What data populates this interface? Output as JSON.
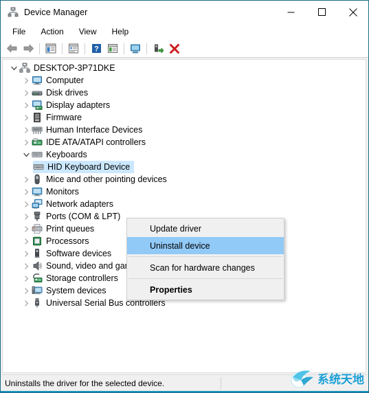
{
  "window": {
    "title": "Device Manager",
    "icon": "device-manager-icon",
    "border_color": "#1b6a8a",
    "controls": [
      {
        "name": "minimize",
        "glyph": "—"
      },
      {
        "name": "maximize",
        "glyph": "□"
      },
      {
        "name": "close",
        "glyph": "✕"
      }
    ]
  },
  "menubar": {
    "items": [
      {
        "label": "File"
      },
      {
        "label": "Action"
      },
      {
        "label": "View"
      },
      {
        "label": "Help"
      }
    ]
  },
  "toolbar": {
    "buttons": [
      {
        "name": "back-icon",
        "tip": "Back"
      },
      {
        "name": "forward-icon",
        "tip": "Forward"
      },
      {
        "name": "show-hide-console-tree-icon",
        "tip": "Show/Hide Console Tree"
      },
      {
        "name": "properties-icon",
        "tip": "Properties"
      },
      {
        "name": "help-icon",
        "tip": "Help"
      },
      {
        "name": "update-driver-icon",
        "tip": "Update Driver Software"
      },
      {
        "name": "scan-hardware-changes-icon",
        "tip": "Scan for hardware changes"
      },
      {
        "name": "enable-device-icon",
        "tip": "Enable device"
      },
      {
        "name": "uninstall-device-icon",
        "tip": "Uninstall device"
      }
    ]
  },
  "tree": {
    "root": {
      "label": "DESKTOP-3P71DKE",
      "icon": "computer-root-icon",
      "expanded": true
    },
    "nodes": [
      {
        "label": "Computer",
        "icon": "computer-icon",
        "expanded": false,
        "selected": false,
        "depth": 1
      },
      {
        "label": "Disk drives",
        "icon": "disk-drive-icon",
        "expanded": false,
        "selected": false,
        "depth": 1
      },
      {
        "label": "Display adapters",
        "icon": "display-adapter-icon",
        "expanded": false,
        "selected": false,
        "depth": 1
      },
      {
        "label": "Firmware",
        "icon": "firmware-icon",
        "expanded": false,
        "selected": false,
        "depth": 1
      },
      {
        "label": "Human Interface Devices",
        "icon": "hid-icon",
        "expanded": false,
        "selected": false,
        "depth": 1
      },
      {
        "label": "IDE ATA/ATAPI controllers",
        "icon": "ide-controller-icon",
        "expanded": false,
        "selected": false,
        "depth": 1
      },
      {
        "label": "Keyboards",
        "icon": "keyboard-icon",
        "expanded": true,
        "selected": false,
        "depth": 1
      },
      {
        "label": "HID Keyboard Device",
        "icon": "keyboard-icon",
        "expanded": null,
        "selected": true,
        "depth": 2
      },
      {
        "label": "Mice and other pointing devices",
        "icon": "mouse-icon",
        "expanded": false,
        "selected": false,
        "depth": 1
      },
      {
        "label": "Monitors",
        "icon": "monitor-icon",
        "expanded": false,
        "selected": false,
        "depth": 1
      },
      {
        "label": "Network adapters",
        "icon": "network-adapter-icon",
        "expanded": false,
        "selected": false,
        "depth": 1
      },
      {
        "label": "Ports (COM & LPT)",
        "icon": "port-icon",
        "expanded": false,
        "selected": false,
        "depth": 1
      },
      {
        "label": "Print queues",
        "icon": "printer-icon",
        "expanded": false,
        "selected": false,
        "depth": 1
      },
      {
        "label": "Processors",
        "icon": "processor-icon",
        "expanded": false,
        "selected": false,
        "depth": 1
      },
      {
        "label": "Software devices",
        "icon": "software-device-icon",
        "expanded": false,
        "selected": false,
        "depth": 1
      },
      {
        "label": "Sound, video and game controllers",
        "icon": "sound-icon",
        "expanded": false,
        "selected": false,
        "depth": 1
      },
      {
        "label": "Storage controllers",
        "icon": "storage-controller-icon",
        "expanded": false,
        "selected": false,
        "depth": 1
      },
      {
        "label": "System devices",
        "icon": "system-device-icon",
        "expanded": false,
        "selected": false,
        "depth": 1
      },
      {
        "label": "Universal Serial Bus controllers",
        "icon": "usb-controller-icon",
        "expanded": false,
        "selected": false,
        "depth": 1
      }
    ]
  },
  "context_menu": {
    "visible": true,
    "highlight_color": "#91c9f7",
    "items": [
      {
        "label": "Update driver",
        "highlighted": false,
        "bold": false,
        "separator_after": false
      },
      {
        "label": "Uninstall device",
        "highlighted": true,
        "bold": false,
        "separator_after": true
      },
      {
        "label": "Scan for hardware changes",
        "highlighted": false,
        "bold": false,
        "separator_after": true
      },
      {
        "label": "Properties",
        "highlighted": false,
        "bold": true,
        "separator_after": false
      }
    ]
  },
  "statusbar": {
    "text": "Uninstalls the driver for the selected device.",
    "watermark_text": "系统天地",
    "watermark_color": "#1a9ed4"
  }
}
